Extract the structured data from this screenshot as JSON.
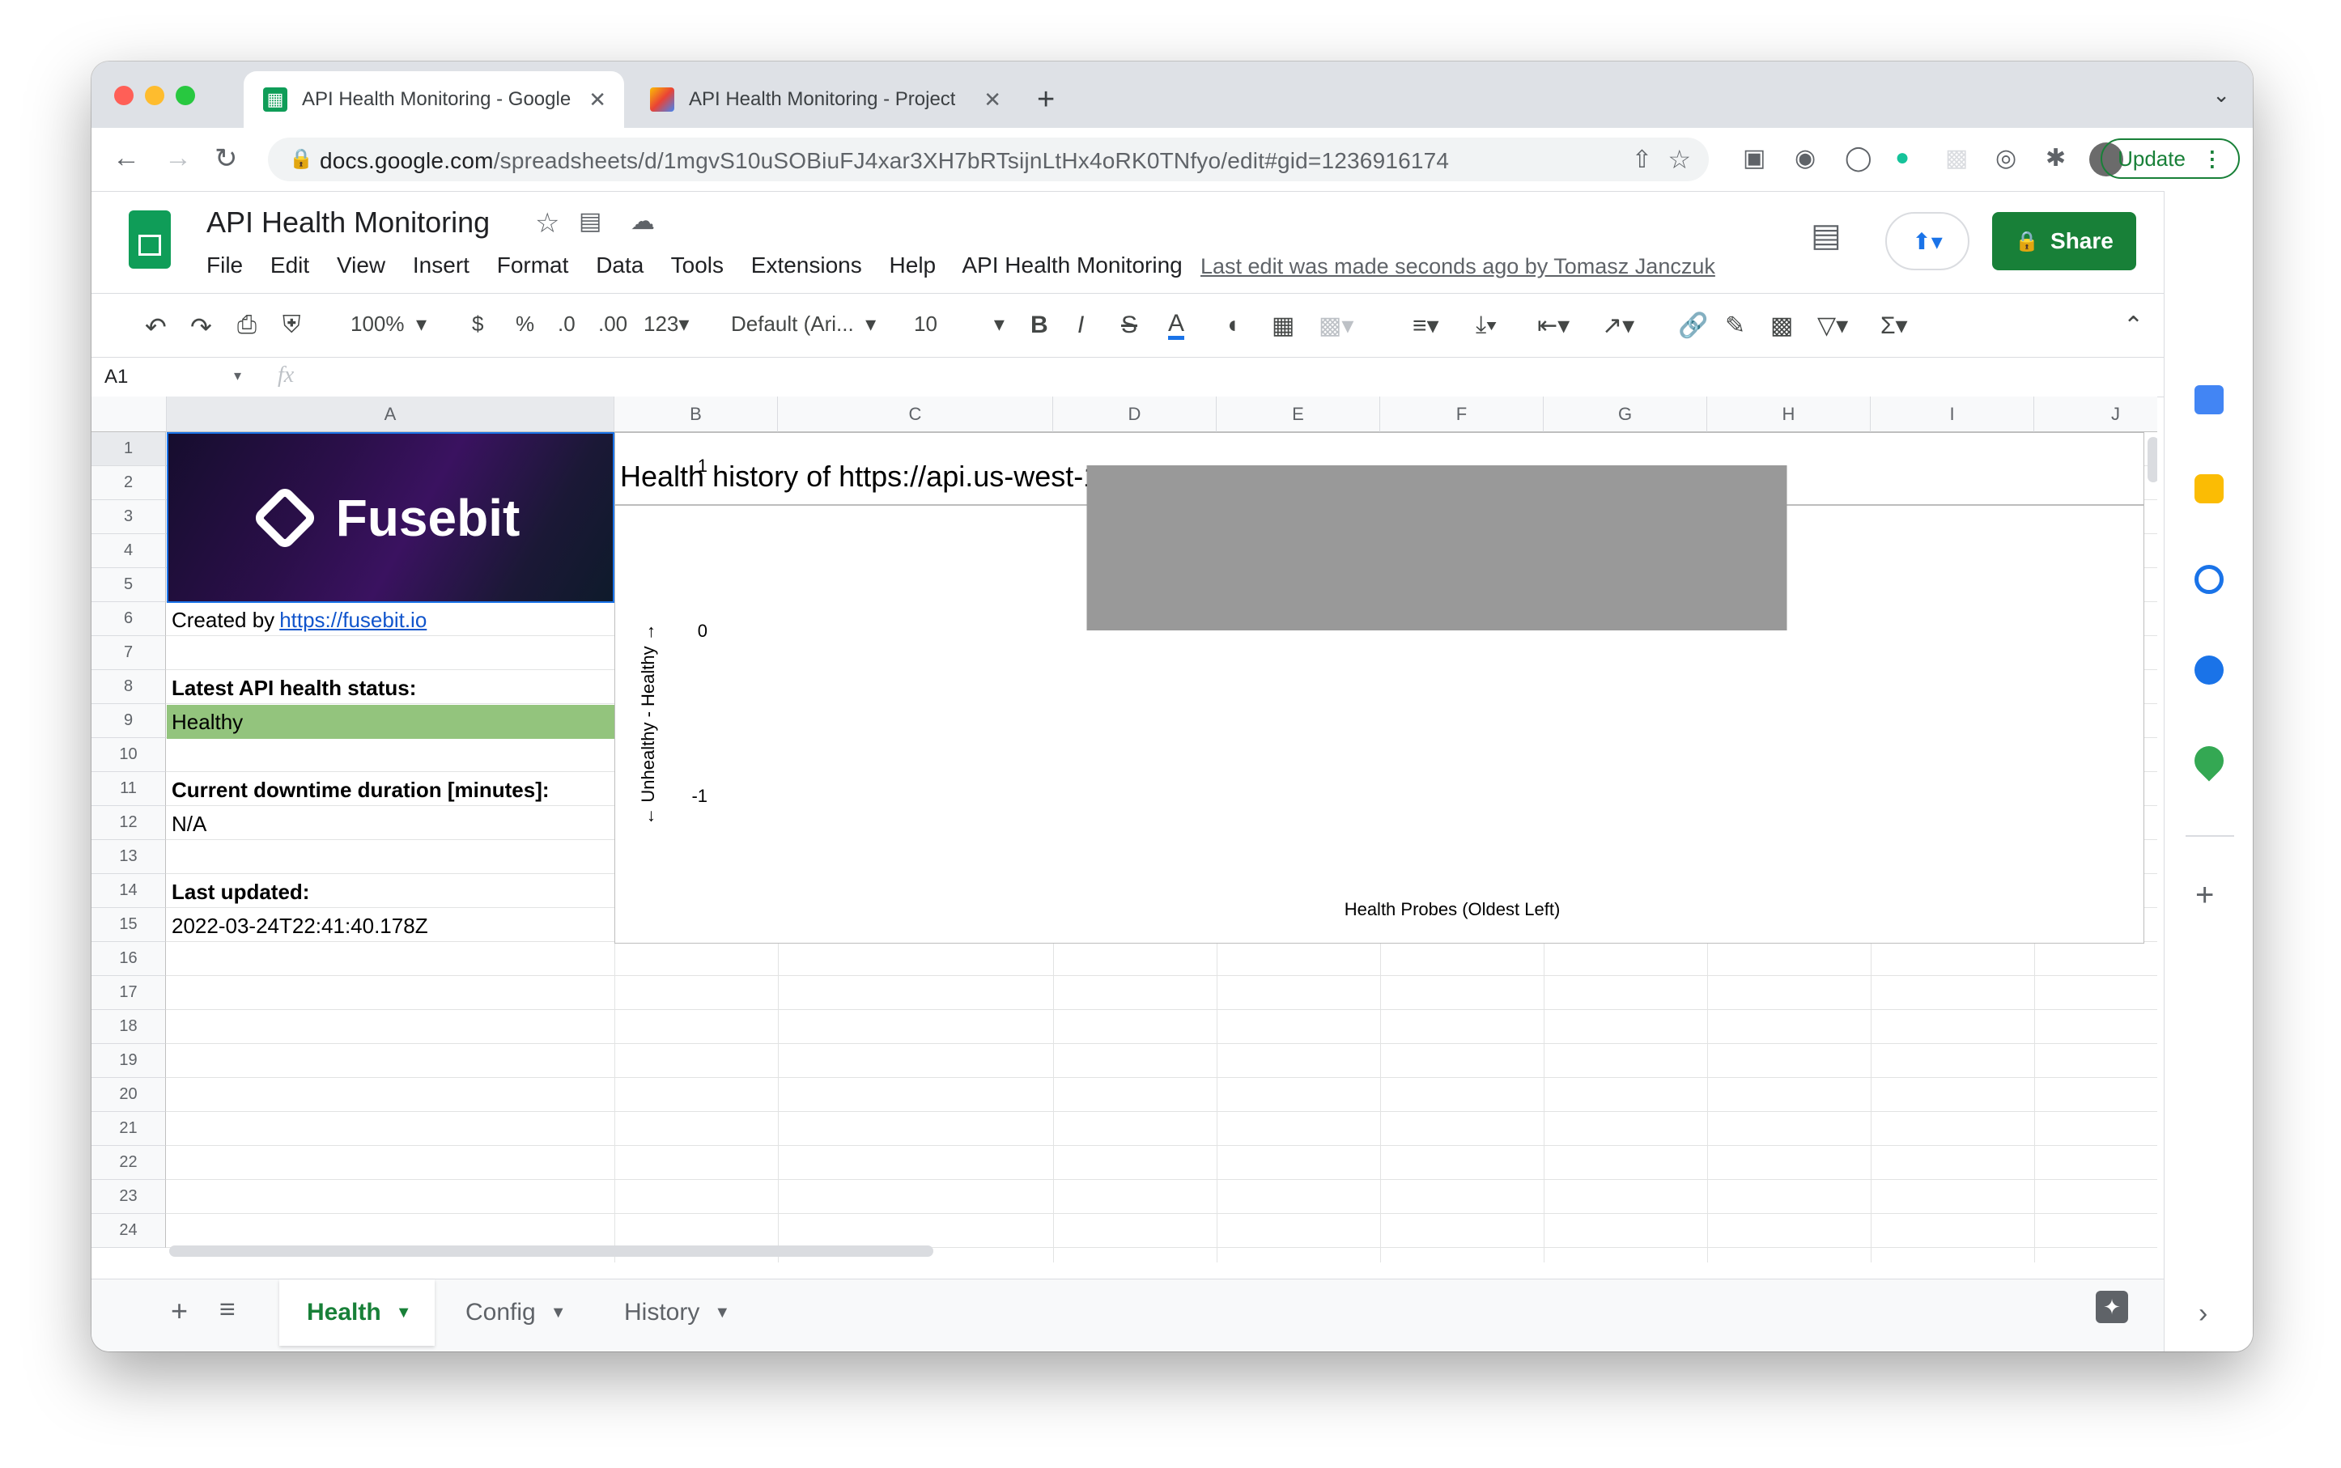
{
  "browser": {
    "tabs": [
      {
        "title": "API Health Monitoring - Google",
        "active": true
      },
      {
        "title": "API Health Monitoring - Project",
        "active": false
      }
    ],
    "url_host": "docs.google.com",
    "url_path": "/spreadsheets/d/1mgvS10uSOBiuFJ4xar3XH7bRTsijnLtHx4oRK0TNfyo/edit#gid=1236916174",
    "update_label": "Update"
  },
  "sheets": {
    "title": "API Health Monitoring",
    "menu": [
      "File",
      "Edit",
      "View",
      "Insert",
      "Format",
      "Data",
      "Tools",
      "Extensions",
      "Help",
      "API Health Monitoring"
    ],
    "last_edit": "Last edit was made seconds ago by Tomasz Janczuk",
    "share_label": "Share"
  },
  "toolbar": {
    "zoom": "100%",
    "currency": "$",
    "percent": "%",
    "dec_decrease": ".0",
    "dec_increase": ".00",
    "number_format": "123",
    "font": "Default (Ari...",
    "font_size": "10"
  },
  "formula_bar": {
    "cell_ref": "A1",
    "fx": "fx"
  },
  "grid": {
    "columns": [
      "A",
      "B",
      "C",
      "D",
      "E",
      "F",
      "G",
      "H",
      "I",
      "J"
    ],
    "rows": [
      "1",
      "2",
      "3",
      "4",
      "5",
      "6",
      "7",
      "8",
      "9",
      "10",
      "11",
      "12",
      "13",
      "14",
      "15",
      "16",
      "17",
      "18",
      "19",
      "20",
      "21",
      "22",
      "23",
      "24"
    ],
    "logo_text": "Fusebit",
    "created_by": "Created by ",
    "created_link": "https://fusebit.io",
    "status_label": "Latest API health status:",
    "status_value": "Healthy",
    "downtime_label": "Current downtime duration [minutes]:",
    "downtime_value": "N/A",
    "updated_label": "Last updated:",
    "updated_value": "2022-03-24T22:41:40.178Z",
    "healthy_color": "#93c47d"
  },
  "chart_data": {
    "type": "bar",
    "title": "Health history of https://api.us-west-1.on.fusebit.io/v1/health (last 24h)",
    "xlabel": "Health Probes (Oldest Left)",
    "ylabel": "← Unhealthy - Healthy →",
    "ylim": [
      -1,
      1
    ],
    "yticks": [
      "1",
      "0",
      "-1"
    ],
    "categories": [
      ""
    ],
    "values": [
      1
    ],
    "bar_color": "#999999",
    "grid": false
  },
  "sheet_tabs": [
    {
      "label": "Health",
      "active": true
    },
    {
      "label": "Config",
      "active": false
    },
    {
      "label": "History",
      "active": false
    }
  ]
}
